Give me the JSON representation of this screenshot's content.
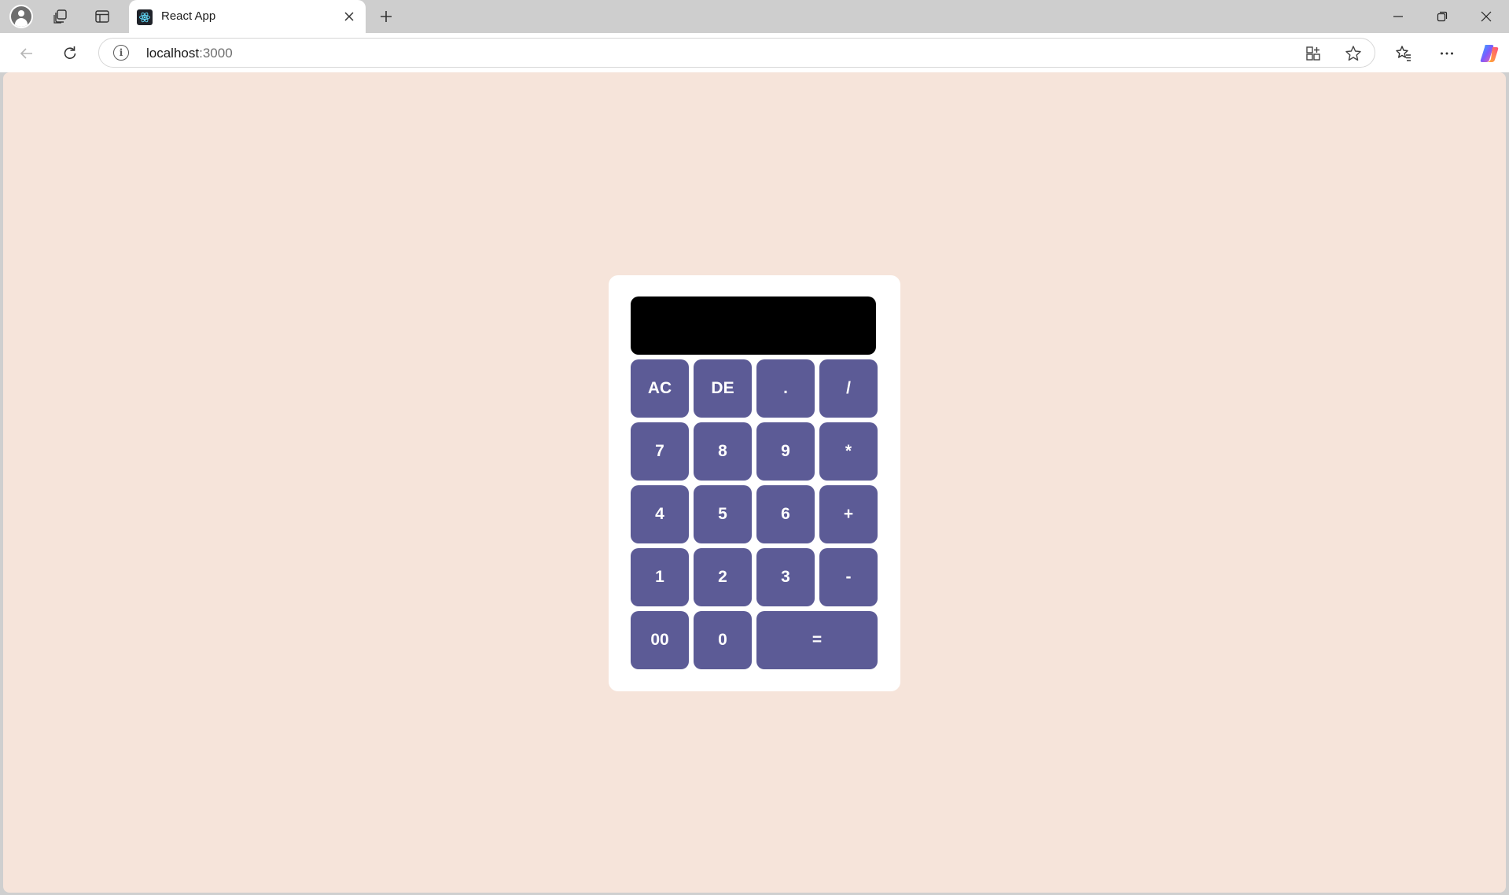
{
  "browser": {
    "tab": {
      "title": "React App"
    },
    "address": {
      "host": "localhost",
      "port": ":3000"
    }
  },
  "calculator": {
    "display_value": "",
    "keys": [
      "AC",
      "DE",
      ".",
      "/",
      "7",
      "8",
      "9",
      "*",
      "4",
      "5",
      "6",
      "+",
      "1",
      "2",
      "3",
      "-",
      "00",
      "0",
      "="
    ]
  },
  "colors": {
    "page_background": "#f6e4da",
    "key_background": "#5c5b96",
    "display_background": "#000000"
  },
  "icons": [
    "profile-icon",
    "workspaces-icon",
    "vertical-tabs-icon",
    "react-favicon-icon",
    "close-icon",
    "plus-icon",
    "minimize-icon",
    "restore-icon",
    "back-icon",
    "refresh-icon",
    "info-icon",
    "app-install-icon",
    "star-icon",
    "favorites-icon",
    "more-icon",
    "copilot-icon"
  ]
}
